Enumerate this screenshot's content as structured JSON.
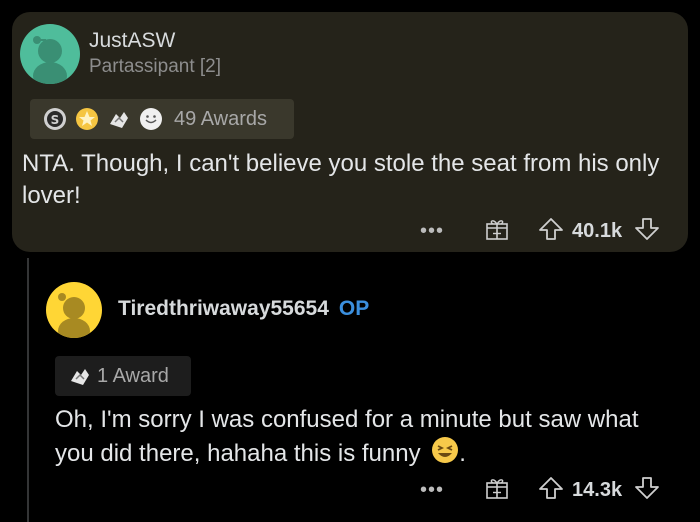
{
  "comments": [
    {
      "username": "JustASW",
      "flair": "Partassipant [2]",
      "awards_label": "49 Awards",
      "award_icons": [
        "silver-award-icon",
        "gold-award-icon",
        "helpful-hands-award-icon",
        "wholesome-award-icon"
      ],
      "text": "NTA. Though, I can't believe you stole the seat from his only lover!",
      "score": "40.1k",
      "more_label": "•••",
      "avatar_color": "#4fbd9b"
    },
    {
      "username": "Tiredthriwaway55654",
      "op_badge": "OP",
      "awards_label": "1 Award",
      "award_icons": [
        "helpful-hands-award-icon"
      ],
      "text": "Oh, I'm sorry I was confused for a minute but saw what you did there, hahaha this is funny",
      "text_end": ".",
      "emoji": "laughing-emoji-icon",
      "score": "14.3k",
      "more_label": "•••",
      "avatar_color": "#ffd635"
    }
  ],
  "colors": {
    "highlight_bg": "#25231a",
    "op_blue": "#3b8fde",
    "background": "#000000"
  }
}
